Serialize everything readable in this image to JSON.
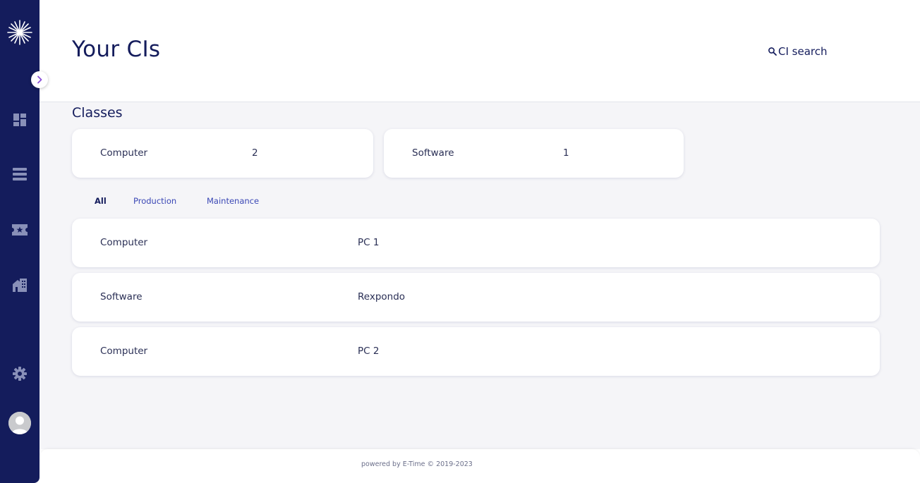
{
  "sidebar": {
    "logo": "star-burst-logo",
    "nav_icons": [
      "dashboard-icon",
      "list-icon",
      "ticket-icon",
      "building-icon",
      "gear-icon"
    ],
    "toggle_icon": "chevron-right-icon",
    "avatar_icon": "user-avatar-icon"
  },
  "header": {
    "title": "Your CIs",
    "search_label": "CI search",
    "search_icon": "search-icon"
  },
  "classes": {
    "title": "Classes",
    "items": [
      {
        "name": "Computer",
        "count": "2"
      },
      {
        "name": "Software",
        "count": "1"
      }
    ]
  },
  "filters": {
    "tabs": [
      "All",
      "Production",
      "Maintenance"
    ],
    "active": "All"
  },
  "cis": [
    {
      "class": "Computer",
      "name": "PC 1"
    },
    {
      "class": "Software",
      "name": "Rexpondo"
    },
    {
      "class": "Computer",
      "name": "PC 2"
    }
  ],
  "footer": {
    "text": "powered by E-Time © 2019-2023"
  },
  "colors": {
    "sidebar": "#141c5c",
    "accent": "#3a47b5",
    "background": "#f5f5f8",
    "toggle_chevron": "#8a4fd8"
  }
}
